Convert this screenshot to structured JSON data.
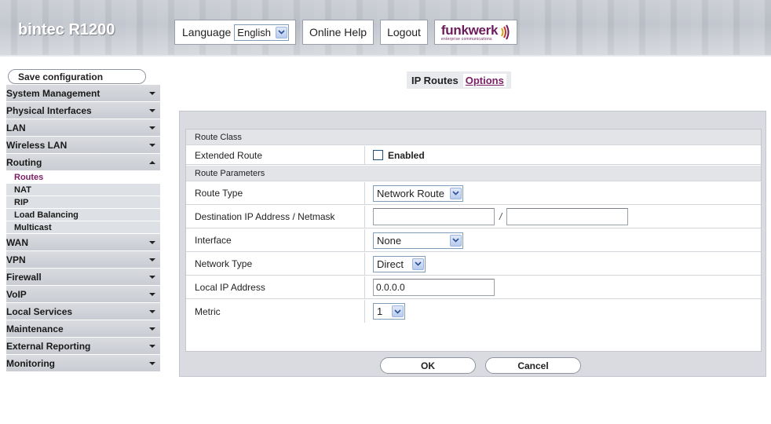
{
  "app": {
    "title": "bintec R1200"
  },
  "header": {
    "language_label": "Language",
    "language_value": "English",
    "help_label": "Online Help",
    "logout_label": "Logout",
    "logo_text": "funkwerk",
    "logo_sub": "enterprise communications"
  },
  "sidebar": {
    "save_label": "Save configuration",
    "items": [
      {
        "label": "System Management"
      },
      {
        "label": "Physical Interfaces"
      },
      {
        "label": "LAN"
      },
      {
        "label": "Wireless LAN"
      },
      {
        "label": "Routing",
        "expanded": true,
        "subitems": [
          "Routes",
          "NAT",
          "RIP",
          "Load Balancing",
          "Multicast"
        ],
        "active_subitem": "Routes"
      },
      {
        "label": "WAN"
      },
      {
        "label": "VPN"
      },
      {
        "label": "Firewall"
      },
      {
        "label": "VoIP"
      },
      {
        "label": "Local Services"
      },
      {
        "label": "Maintenance"
      },
      {
        "label": "External Reporting"
      },
      {
        "label": "Monitoring"
      }
    ]
  },
  "tabs": [
    {
      "label": "IP Routes",
      "active": true
    },
    {
      "label": "Options",
      "active": false
    }
  ],
  "form": {
    "section_route_class": "Route Class",
    "extended_route_label": "Extended Route",
    "extended_route_checkbox": "Enabled",
    "section_route_params": "Route Parameters",
    "route_type_label": "Route Type",
    "route_type_value": "Network Route",
    "dest_label": "Destination IP Address / Netmask",
    "dest_ip_value": "",
    "dest_netmask_value": "",
    "dest_separator": "/",
    "interface_label": "Interface",
    "interface_value": "None",
    "network_type_label": "Network Type",
    "network_type_value": "Direct",
    "local_ip_label": "Local IP Address",
    "local_ip_value": "0.0.0.0",
    "metric_label": "Metric",
    "metric_value": "1",
    "ok_label": "OK",
    "cancel_label": "Cancel"
  },
  "colors": {
    "accent": "#7a1e65",
    "nav_bg": "#cfd2d8"
  }
}
